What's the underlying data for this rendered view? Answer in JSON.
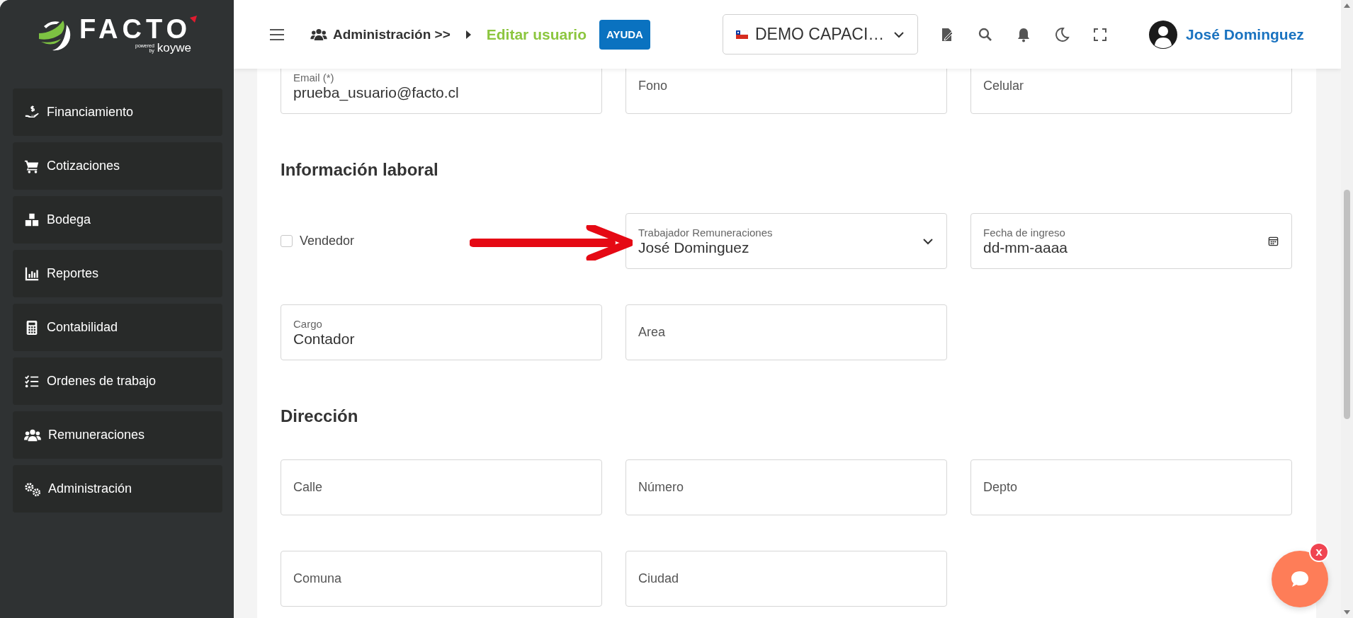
{
  "logo": {
    "wordmark": "FACTO",
    "powered": "powered",
    "by": "by",
    "brand": "koywe"
  },
  "sidebar": {
    "items": [
      {
        "label": "Financiamiento"
      },
      {
        "label": "Cotizaciones"
      },
      {
        "label": "Bodega"
      },
      {
        "label": "Reportes"
      },
      {
        "label": "Contabilidad"
      },
      {
        "label": "Ordenes de trabajo"
      },
      {
        "label": "Remuneraciones"
      },
      {
        "label": "Administración"
      }
    ]
  },
  "header": {
    "breadcrumb": [
      {
        "label": "Administración >>",
        "current": false
      },
      {
        "label": "Editar usuario",
        "current": true
      }
    ],
    "help_button": "AYUDA",
    "company_select": "DEMO CAPACI…",
    "user_name": "José Dominguez"
  },
  "form": {
    "sections": [
      {
        "fields": [
          {
            "kind": "text",
            "label": "Email (*)",
            "value": "prueba_usuario@facto.cl"
          },
          {
            "kind": "text",
            "placeholder": "Fono"
          },
          {
            "kind": "text",
            "placeholder": "Celular"
          }
        ]
      },
      {
        "title": "Información laboral",
        "fields": [
          {
            "kind": "checkbox",
            "label": "Vendedor",
            "checked": false
          },
          {
            "kind": "select",
            "label": "Trabajador Remuneraciones",
            "value": "José Dominguez"
          },
          {
            "kind": "date",
            "label": "Fecha de ingreso",
            "value": "dd-mm-aaaa"
          },
          {
            "kind": "text",
            "label": "Cargo",
            "value": "Contador"
          },
          {
            "kind": "text",
            "placeholder": "Area"
          }
        ]
      },
      {
        "title": "Dirección",
        "fields": [
          {
            "kind": "text",
            "placeholder": "Calle"
          },
          {
            "kind": "text",
            "placeholder": "Número"
          },
          {
            "kind": "text",
            "placeholder": "Depto"
          },
          {
            "kind": "text",
            "placeholder": "Comuna"
          },
          {
            "kind": "text",
            "placeholder": "Ciudad"
          }
        ]
      }
    ]
  },
  "chat": {
    "close_badge": "x"
  }
}
